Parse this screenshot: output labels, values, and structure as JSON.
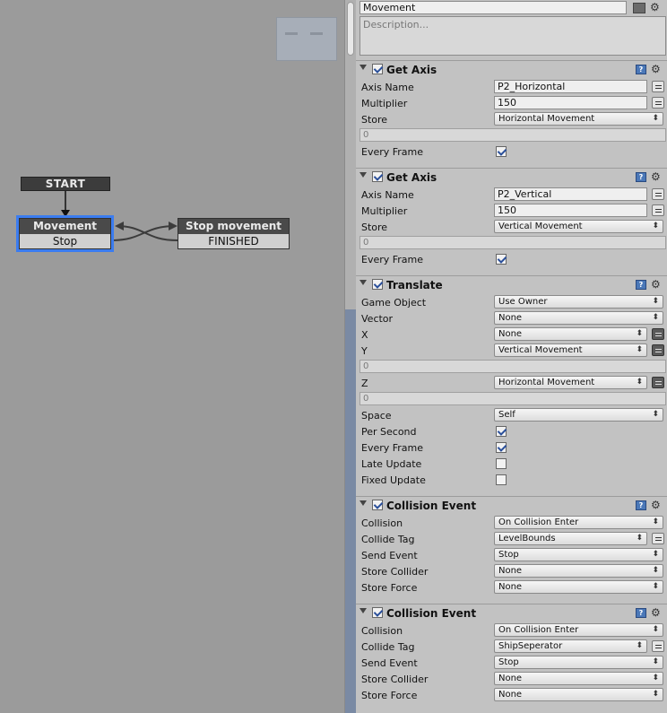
{
  "graph": {
    "start_label": "START",
    "states": [
      {
        "name": "Movement",
        "event": "Stop"
      },
      {
        "name": "Stop movement",
        "event": "FINISHED"
      }
    ]
  },
  "inspector": {
    "state_name": "Movement",
    "description_placeholder": "Description...",
    "actions": [
      {
        "title": "Get Axis",
        "enabled": true,
        "rows": [
          {
            "kind": "text",
            "label": "Axis Name",
            "value": "P2_Horizontal",
            "eq": true
          },
          {
            "kind": "text",
            "label": "Multiplier",
            "value": "150",
            "eq": true
          },
          {
            "kind": "select",
            "label": "Store",
            "value": "Horizontal Movement"
          },
          {
            "kind": "value",
            "value": "0"
          },
          {
            "kind": "check",
            "label": "Every Frame",
            "checked": true
          }
        ]
      },
      {
        "title": "Get Axis",
        "enabled": true,
        "rows": [
          {
            "kind": "text",
            "label": "Axis Name",
            "value": "P2_Vertical",
            "eq": true
          },
          {
            "kind": "text",
            "label": "Multiplier",
            "value": "150",
            "eq": true
          },
          {
            "kind": "select",
            "label": "Store",
            "value": "Vertical Movement"
          },
          {
            "kind": "value",
            "value": "0"
          },
          {
            "kind": "check",
            "label": "Every Frame",
            "checked": true
          }
        ]
      },
      {
        "title": "Translate",
        "enabled": true,
        "rows": [
          {
            "kind": "select",
            "label": "Game Object",
            "value": "Use Owner"
          },
          {
            "kind": "select",
            "label": "Vector",
            "value": "None"
          },
          {
            "kind": "select",
            "label": "X",
            "value": "None",
            "eq": true,
            "dark": true
          },
          {
            "kind": "select",
            "label": "Y",
            "value": "Vertical Movement",
            "eq": true,
            "dark": true
          },
          {
            "kind": "value",
            "value": "0"
          },
          {
            "kind": "select",
            "label": "Z",
            "value": "Horizontal Movement",
            "eq": true,
            "dark": true
          },
          {
            "kind": "value",
            "value": "0"
          },
          {
            "kind": "select",
            "label": "Space",
            "value": "Self"
          },
          {
            "kind": "check",
            "label": "Per Second",
            "checked": true
          },
          {
            "kind": "check",
            "label": "Every Frame",
            "checked": true
          },
          {
            "kind": "check",
            "label": "Late Update",
            "checked": false
          },
          {
            "kind": "check",
            "label": "Fixed Update",
            "checked": false
          }
        ]
      },
      {
        "title": "Collision Event",
        "enabled": true,
        "rows": [
          {
            "kind": "select",
            "label": "Collision",
            "value": "On Collision Enter"
          },
          {
            "kind": "select",
            "label": "Collide Tag",
            "value": "LevelBounds",
            "eq": true
          },
          {
            "kind": "select",
            "label": "Send Event",
            "value": "Stop"
          },
          {
            "kind": "select",
            "label": "Store Collider",
            "value": "None"
          },
          {
            "kind": "select",
            "label": "Store Force",
            "value": "None"
          }
        ]
      },
      {
        "title": "Collision Event",
        "enabled": true,
        "rows": [
          {
            "kind": "select",
            "label": "Collision",
            "value": "On Collision Enter"
          },
          {
            "kind": "select",
            "label": "Collide Tag",
            "value": "ShipSeperator",
            "eq": true
          },
          {
            "kind": "select",
            "label": "Send Event",
            "value": "Stop"
          },
          {
            "kind": "select",
            "label": "Store Collider",
            "value": "None"
          },
          {
            "kind": "select",
            "label": "Store Force",
            "value": "None"
          }
        ]
      }
    ]
  }
}
